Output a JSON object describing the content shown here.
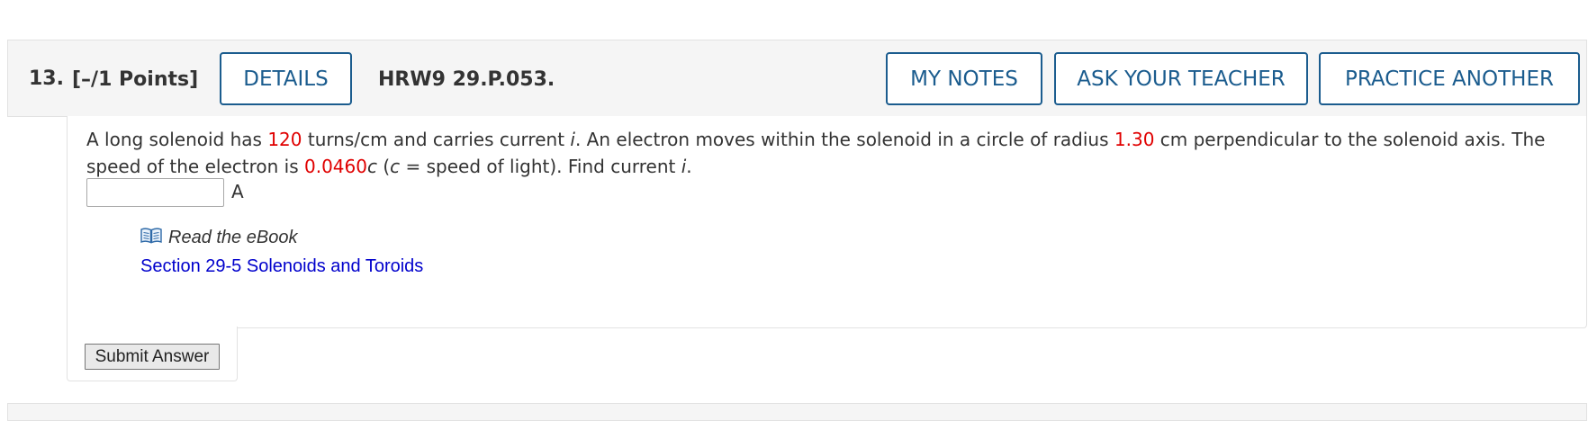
{
  "question": {
    "number": "13.",
    "points": "[–/1 Points]",
    "code": "HRW9 29.P.053."
  },
  "header_buttons": {
    "details": "DETAILS",
    "my_notes": "MY NOTES",
    "ask_teacher": "ASK YOUR TEACHER",
    "practice_another": "PRACTICE ANOTHER"
  },
  "body": {
    "t1": "A long solenoid has ",
    "turns": "120",
    "t2": " turns/cm and carries current ",
    "current_var": "i",
    "t3": ". An electron moves within the solenoid in a circle of radius ",
    "radius": "1.30",
    "t4": " cm perpendicular to the solenoid axis. The speed of the electron is ",
    "speed": "0.0460",
    "c_var": "c",
    "t5": " (",
    "c_var2": "c",
    "t6": " = speed of light). Find current ",
    "current_var2": "i",
    "t7": "."
  },
  "answer": {
    "value": "",
    "unit": "A"
  },
  "resources": {
    "ebook_label": "Read the eBook",
    "section_link": "Section 29-5 Solenoids and Toroids"
  },
  "submit_label": "Submit Answer",
  "colors": {
    "accent": "#1b5c8e",
    "given_value": "#e00000",
    "link": "#0000cc",
    "header_bg": "#f5f5f5"
  },
  "icons": {
    "ebook": "open-book-icon"
  }
}
